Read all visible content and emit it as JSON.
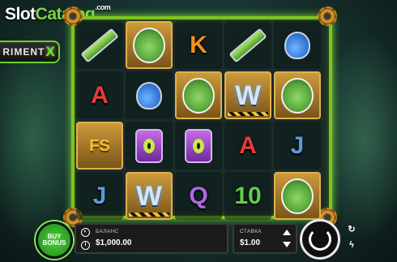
{
  "watermark": {
    "brand_a": "Slot",
    "brand_b": "Catalog",
    "suffix": ".com"
  },
  "game_title": {
    "text": "RIMENT",
    "x_mark": "X"
  },
  "reels": [
    [
      {
        "type": "syringe",
        "icon": "syringe-icon"
      },
      {
        "type": "letter",
        "value": "A",
        "cls": "A"
      },
      {
        "type": "framed-letter",
        "value": "FS",
        "cls": "FS"
      },
      {
        "type": "letter",
        "value": "J",
        "cls": "J"
      }
    ],
    [
      {
        "type": "framed-face",
        "icon": "scientist-wild-icon"
      },
      {
        "type": "flask",
        "icon": "flask-icon"
      },
      {
        "type": "jar",
        "icon": "eye-jar-icon"
      },
      {
        "type": "framed-w",
        "value": "W",
        "cls": "W"
      }
    ],
    [
      {
        "type": "letter",
        "value": "K",
        "cls": "K"
      },
      {
        "type": "framed-face",
        "icon": "scientist-wild-icon"
      },
      {
        "type": "jar",
        "icon": "eye-jar-icon"
      },
      {
        "type": "letter",
        "value": "Q",
        "cls": "Q"
      }
    ],
    [
      {
        "type": "syringe",
        "icon": "syringe-icon"
      },
      {
        "type": "framed-w",
        "value": "W",
        "cls": "W"
      },
      {
        "type": "letter",
        "value": "A",
        "cls": "A"
      },
      {
        "type": "letter",
        "value": "10",
        "cls": "T"
      }
    ],
    [
      {
        "type": "flask",
        "icon": "flask-icon"
      },
      {
        "type": "framed-face",
        "icon": "scientist-wild-icon"
      },
      {
        "type": "letter",
        "value": "J",
        "cls": "J"
      },
      {
        "type": "framed-face",
        "icon": "scientist-wild-icon"
      }
    ]
  ],
  "buy_bonus": {
    "line1": "BUY",
    "line2": "BONUS"
  },
  "balance": {
    "label": "БАЛАНС",
    "value": "$1,000.00"
  },
  "bet": {
    "label": "СТАВКА",
    "value": "$1.00"
  },
  "side_buttons": {
    "autoplay": "↻",
    "turbo": "ϟ"
  },
  "colors": {
    "accent": "#7fc31f",
    "panel": "#1b1b1b"
  }
}
